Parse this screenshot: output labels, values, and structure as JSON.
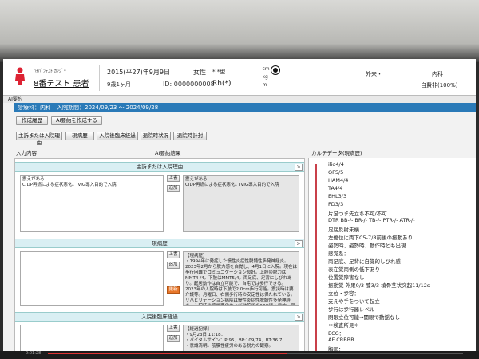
{
  "patient": {
    "kana": "ﾊﾁﾊﾞﾝﾃｽﾄ ｶﾝｼﾞｬ",
    "name": "8番テスト 患者",
    "dob": "2015(平27)年9月9日",
    "age": "9歳1ヶ月",
    "sex": "女性",
    "id_label": "ID:",
    "id": "0000000008",
    "blood_label": "* *型",
    "rh": "Rh(*)",
    "height": "---cm",
    "weight": "---kg",
    "bmi": "---m",
    "gairai": "外来・",
    "dept": "内科",
    "payment": "自費非(100%)"
  },
  "window": {
    "title": "AI要約"
  },
  "period": {
    "text": "診療科：内科　入院期間：2024/09/23 ～ 2024/09/28"
  },
  "toolbar": {
    "history_btn": "作成履歴",
    "ai_btn": "AI要約を作成する"
  },
  "tabs": [
    {
      "label": "主訴または入院理由"
    },
    {
      "label": "現病歴"
    },
    {
      "label": "入院後臨床経過"
    },
    {
      "label": "退院時状況"
    },
    {
      "label": "退院時計封"
    }
  ],
  "panes": {
    "input_label": "入力内容",
    "ai_label": "AI要約結果",
    "karte_label": "カルテデータ(現病歴)"
  },
  "sections": {
    "reason": {
      "title": "主訴または入院理由",
      "input": "震えがある\nCIDP再燃による症状悪化。IVIG導入目的で入院",
      "ai": "震えがある\nCIDP再燃による症状悪化。IVIG導入目的で入院"
    },
    "history": {
      "title": "現病歴",
      "input": "【現病歴】\n・1994年に発症した慢性炎症性脱髄性多発神経炎。2023年2月から脱力感を自覚し、4月1日に入院。現在は歩行困難でコミュニケーション良好。上肢の脱力はMMT4-/4。下肢はMMT5/4。両足底、足背にしびれあり。起居動作は自立可能で、自宅では歩行できる。2023年の入院時は下肢で2.0cm歩行可能。震災時は要介護等。月曜日、右側歩行時の安定性は保たれている。リハビリテーション病院は慢性炎症性脱髄性多発神経炎。入院時の症状悪化および他院でのIVIG導入目的。現在は歩行時の揺れあり。MMTは両下肢4-/4、上肢iliac 3/4、下肢iliac 4/4。",
      "update_btn": "更新"
    },
    "course": {
      "title": "入院後臨床経過",
      "input": "【経過記録】\n・9月23日 11:18：\n・バイタルサイン：P:95、BP:109/74、BT:36.7\n・意識清明。筋膜性疲労のある脱力の観察。"
    }
  },
  "buttons": {
    "upper": "上書",
    "append": "追加"
  },
  "karte": {
    "lines": [
      "ilio4/4",
      "QF5/5",
      "HAM4/4",
      "TA4/4",
      "EHL3/3",
      "FD3/3",
      "片足つま先立ち不可/不可",
      "DTR BB-/- BR-/- TB-/- PTR-/- ATR-/-",
      "足底反射未検",
      "左優位に両下C5-7/8前後の振動あり",
      "姿勢時、姿勢時、動作時とも出現",
      "感覚系：",
      "両足底、足背に自覚的しびれ感",
      "表在覚両側の低下あり",
      "位置覚障害なし",
      "振動覚 外果0/3 膝3/3 橈骨茎状突起11/12s",
      "立位・歩容：",
      "支えや手をついて起立",
      "歩行は歩行器レベル",
      "閉眼立位可能→開眼で動揺なし",
      "＊検査所見＊",
      "ECG：",
      "AF CRBBB",
      "胸部："
    ]
  },
  "playback": {
    "current": "0:01:28",
    "total": ""
  }
}
